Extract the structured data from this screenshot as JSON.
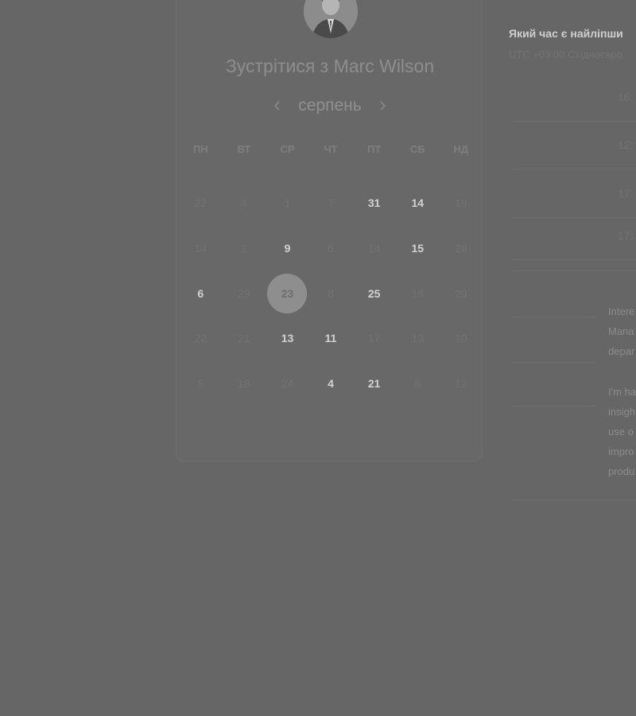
{
  "meeting": {
    "title": "Зустрітися з Marc Wilson"
  },
  "calendar": {
    "month": "серпень",
    "prev_icon": "chevron-left-icon",
    "next_icon": "chevron-right-icon",
    "weekdays": [
      "ПН",
      "ВТ",
      "СР",
      "ЧТ",
      "ПТ",
      "СБ",
      "НД"
    ],
    "weeks": [
      [
        {
          "label": "22",
          "active": false
        },
        {
          "label": "4",
          "active": false
        },
        {
          "label": "1",
          "active": false
        },
        {
          "label": "7",
          "active": false
        },
        {
          "label": "31",
          "active": true
        },
        {
          "label": "14",
          "active": true
        },
        {
          "label": "19",
          "active": false
        }
      ],
      [
        {
          "label": "14",
          "active": false
        },
        {
          "label": "2",
          "active": false
        },
        {
          "label": "9",
          "active": true
        },
        {
          "label": "6",
          "active": false
        },
        {
          "label": "14",
          "active": false
        },
        {
          "label": "15",
          "active": true
        },
        {
          "label": "28",
          "active": false
        }
      ],
      [
        {
          "label": "6",
          "active": true
        },
        {
          "label": "29",
          "active": false
        },
        {
          "label": "23",
          "active": true,
          "selected": true
        },
        {
          "label": "8",
          "active": false
        },
        {
          "label": "25",
          "active": true
        },
        {
          "label": "18",
          "active": false
        },
        {
          "label": "29",
          "active": false
        }
      ],
      [
        {
          "label": "22",
          "active": false
        },
        {
          "label": "21",
          "active": false
        },
        {
          "label": "13",
          "active": true
        },
        {
          "label": "11",
          "active": true
        },
        {
          "label": "17",
          "active": false
        },
        {
          "label": "13",
          "active": false
        },
        {
          "label": "10",
          "active": false
        }
      ],
      [
        {
          "label": "5",
          "active": false
        },
        {
          "label": "18",
          "active": false
        },
        {
          "label": "24",
          "active": false
        },
        {
          "label": "4",
          "active": true
        },
        {
          "label": "21",
          "active": true
        },
        {
          "label": "8",
          "active": false
        },
        {
          "label": "12",
          "active": false
        }
      ]
    ]
  },
  "times_panel": {
    "heading": "Який час є найліпши",
    "timezone": "UTC +03:00 Східноєвро",
    "slots": [
      "16:",
      "12:",
      "17:",
      "17:"
    ]
  },
  "description": {
    "para1": [
      "Intere",
      "Mana",
      "depar"
    ],
    "para2": [
      "I'm ha",
      "insigh",
      "use o",
      "impro",
      "produ"
    ]
  }
}
